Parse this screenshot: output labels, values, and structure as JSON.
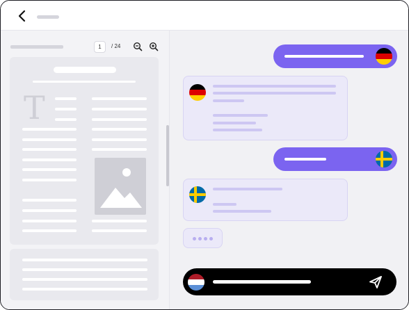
{
  "header": {
    "back_icon": "chevron-left-icon"
  },
  "pdf_toolbar": {
    "page_current": "1",
    "page_total": "/ 24",
    "zoom_out_icon": "zoom-out-icon",
    "zoom_in_icon": "zoom-in-icon"
  },
  "document": {
    "text_glyph": "T",
    "image_placeholder_icon": "image-icon"
  },
  "chat": {
    "messages": [
      {
        "direction": "outgoing",
        "flag": "germany-flag-icon"
      },
      {
        "direction": "incoming",
        "flag": "germany-flag-icon"
      },
      {
        "direction": "outgoing",
        "flag": "sweden-flag-icon"
      },
      {
        "direction": "incoming",
        "flag": "sweden-flag-icon"
      }
    ],
    "typing_indicator": "typing-dots",
    "input_flag": "netherlands-flag-icon",
    "send_icon": "send-icon"
  },
  "colors": {
    "accent": "#7b64f0",
    "incoming_bubble": "#ebe9f9",
    "input_bar": "#000000",
    "pane_left": "#f3f3f6",
    "pane_right": "#f1f1f4"
  }
}
